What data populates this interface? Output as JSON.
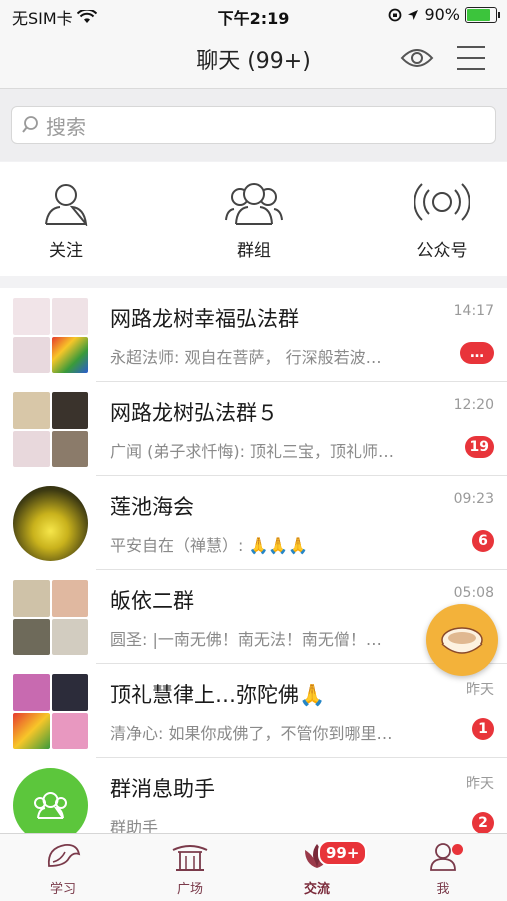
{
  "status_bar": {
    "carrier": "无SIM卡",
    "time": "下午2:19",
    "battery": "90%",
    "battery_level": 0.9
  },
  "header": {
    "title": "聊天 (99+)",
    "icons": [
      "eye-icon",
      "menu-icon"
    ]
  },
  "search": {
    "placeholder": "搜索"
  },
  "quick_actions": [
    {
      "label": "关注",
      "icon": "person-icon"
    },
    {
      "label": "群组",
      "icon": "group-icon"
    },
    {
      "label": "公众号",
      "icon": "broadcast-icon"
    }
  ],
  "chats": [
    {
      "name": "网路龙树幸福弘法群",
      "message": "永超法师: 观自在菩萨， 行深般若波…",
      "time": "14:17",
      "badge": "…"
    },
    {
      "name": "网路龙树弘法群５",
      "message": "广闻 (弟子求忏悔): 顶礼三宝，顶礼师…",
      "time": "12:20",
      "badge": "19"
    },
    {
      "name": "莲池海会",
      "message": "平安自在（禅慧）: 🙏🙏🙏",
      "time": "09:23",
      "badge": "6"
    },
    {
      "name": "皈依二群",
      "message": "圆圣: |一南无佛！南无法！南无僧！…",
      "time": "05:08",
      "badge": ""
    },
    {
      "name": "顶礼慧律上…弥陀佛🙏",
      "message": "清净心: 如果你成佛了，不管你到哪里…",
      "time": "昨天",
      "badge": "1"
    },
    {
      "name": "群消息助手",
      "message": "群助手",
      "time": "昨天",
      "badge": "2"
    }
  ],
  "tabs": [
    {
      "label": "学习",
      "icon": "conch-icon"
    },
    {
      "label": "广场",
      "icon": "temple-icon"
    },
    {
      "label": "交流",
      "icon": "lotus-icon",
      "badge": "99+"
    },
    {
      "label": "我",
      "icon": "monk-icon"
    }
  ],
  "colors": {
    "badge": "#e8343a",
    "tab_tint": "#7a3a4a",
    "assistant_avatar": "#5cc63c",
    "float_button": "#f3b23a"
  }
}
